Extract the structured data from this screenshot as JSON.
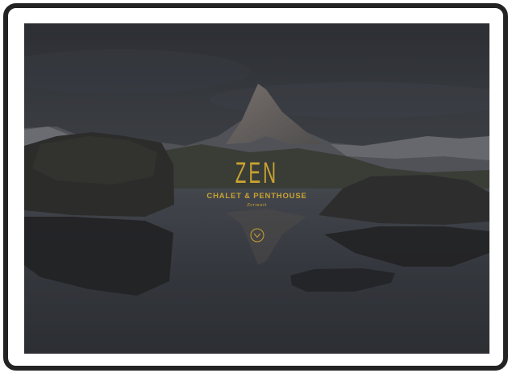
{
  "hero": {
    "logo_text": "ZEN",
    "subtitle": "CHALET & PENTHOUSE",
    "location": "Zermatt",
    "scroll_icon": "chevron-down-circle-icon",
    "accent_color": "#c8a231"
  }
}
